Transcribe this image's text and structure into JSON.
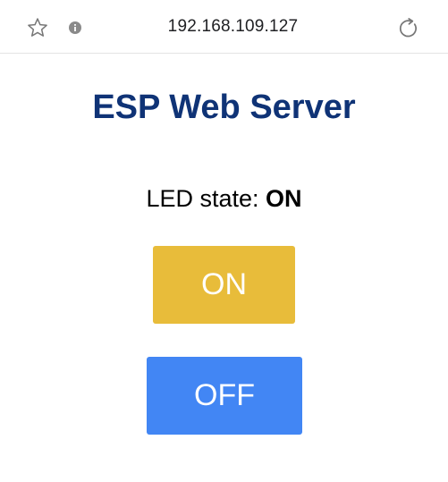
{
  "browser": {
    "url": "192.168.109.127",
    "icons": [
      "star-icon",
      "info-icon",
      "reload-icon"
    ]
  },
  "page": {
    "title": "ESP Web Server",
    "state_label": "LED state: ",
    "state_value": "ON",
    "on_button": "ON",
    "off_button": "OFF"
  },
  "colors": {
    "title": "#0f3376",
    "on_button": "#e8bc3a",
    "off_button": "#4286f4"
  }
}
